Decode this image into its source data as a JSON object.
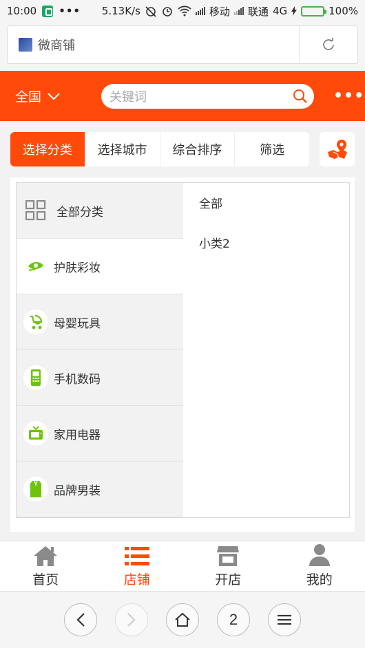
{
  "status_bar": {
    "time": "10:00",
    "dots": "•••",
    "speed": "5.13K/s",
    "carrier1": "移动",
    "carrier2": "联通",
    "network": "4G",
    "battery": "100%",
    "battery_level": 1.0
  },
  "browser": {
    "address_text": "微商铺",
    "tab_count": "2"
  },
  "header": {
    "region": "全国",
    "search_placeholder": "关键词",
    "more": "•••"
  },
  "filter_tabs": [
    {
      "label": "选择分类",
      "active": true
    },
    {
      "label": "选择城市",
      "active": false
    },
    {
      "label": "综合排序",
      "active": false
    },
    {
      "label": "筛选",
      "active": false
    }
  ],
  "categories": [
    {
      "label": "全部分类",
      "icon": "grid-icon"
    },
    {
      "label": "护肤彩妆",
      "icon": "eye-makeup-icon",
      "selected": true
    },
    {
      "label": "母婴玩具",
      "icon": "stroller-icon"
    },
    {
      "label": "手机数码",
      "icon": "phone-icon"
    },
    {
      "label": "家用电器",
      "icon": "tv-icon"
    },
    {
      "label": "品牌男装",
      "icon": "clothing-icon"
    }
  ],
  "subcategories": [
    "全部",
    "小类2"
  ],
  "tabbar": [
    {
      "label": "首页",
      "icon": "home-icon",
      "active": false
    },
    {
      "label": "店铺",
      "icon": "list-icon",
      "active": true
    },
    {
      "label": "开店",
      "icon": "store-icon",
      "active": false
    },
    {
      "label": "我的",
      "icon": "user-icon",
      "active": false
    }
  ],
  "colors": {
    "accent": "#ff4a09",
    "category_icon": "#6cc50a",
    "tabbar_icon": "#8a8a8a"
  }
}
